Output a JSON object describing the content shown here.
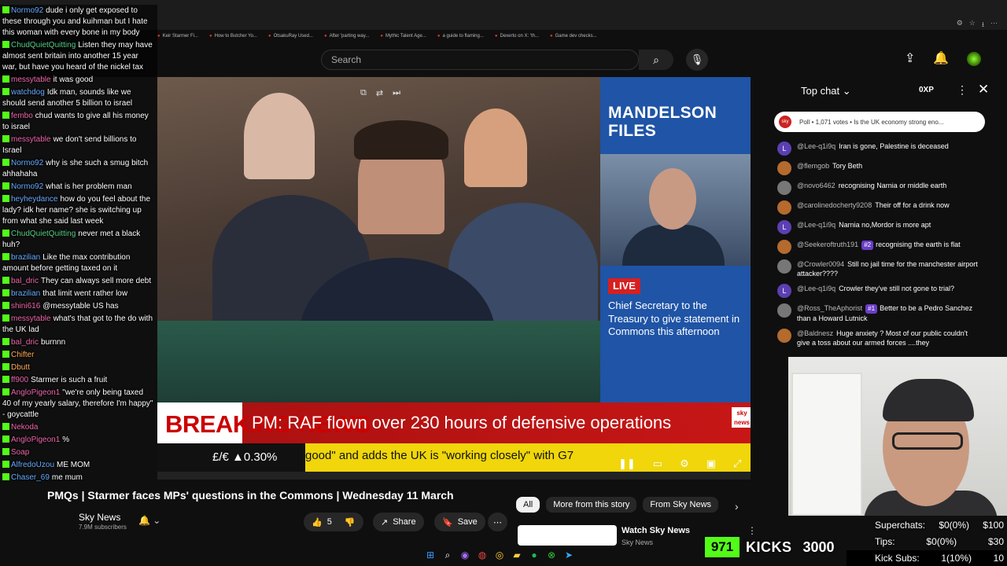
{
  "browser": {
    "bookmarks": [
      "Keir Starmer Fi...",
      "How to Butcher Yo...",
      "OtsakuRay Used...",
      "After 'parting way...",
      "Mythic Talent Age...",
      "a guide to flaming...",
      "Dexerto on X: 'th...",
      "Game dev checks..."
    ]
  },
  "header": {
    "search_placeholder": "Search"
  },
  "video": {
    "side_title": "MANDELSON FILES",
    "live_label": "LIVE",
    "side_description": "Chief Secretary to the Treasury to give statement in Commons this afternoon",
    "breaking_label": "BREAKING NEWS",
    "headline": "PM: RAF flown over 230 hours of defensive operations",
    "sky_logo": "sky news",
    "currency": "£/€ ▲0.30%",
    "ticker": "good\" and adds the UK is \"working closely\" with G7"
  },
  "below": {
    "title": "PMQs | Starmer faces MPs' questions in the Commons | Wednesday 11 March",
    "channel": "Sky News",
    "subscribers": "7.9M subscribers",
    "likes": "5",
    "share_label": "Share",
    "save_label": "Save",
    "chips": [
      "All",
      "More from this story",
      "From Sky News"
    ],
    "rec_title": "Watch Sky News",
    "rec_channel": "Sky News"
  },
  "stream_chat": [
    {
      "user": "Normo92",
      "text": "dude i only get exposed to these through you and kuihman but I hate this woman with every bone in my body",
      "c": "c1"
    },
    {
      "user": "ChudQuietQuitting",
      "text": "Listen they may have almost sent britain into another 15 year war, but have you heard of the nickel tax",
      "c": "c2"
    },
    {
      "user": "messytable",
      "text": "it was good",
      "c": "c3"
    },
    {
      "user": "watchdog",
      "text": "Idk man, sounds like we should send another 5 billion to israel",
      "c": "c1"
    },
    {
      "user": "fembo",
      "text": "chud wants to give all his money to israel",
      "c": "c3"
    },
    {
      "user": "messytable",
      "text": "we don't send billions to Israel",
      "c": "c3"
    },
    {
      "user": "Normo92",
      "text": "why is she such a smug bitch ahhahaha",
      "c": "c1"
    },
    {
      "user": "Normo92",
      "text": "what is her problem man",
      "c": "c1"
    },
    {
      "user": "heyheydance",
      "text": "how do you feel about the lady? idk her name? she is switching up from what she said last week",
      "c": "c1"
    },
    {
      "user": "ChudQuietQuitting",
      "text": "never met a black huh?",
      "c": "c2"
    },
    {
      "user": "brazilian",
      "text": "Like the max contribution amount before getting taxed on it",
      "c": "c1"
    },
    {
      "user": "bal_dric",
      "text": "They can always sell more debt",
      "c": "c3"
    },
    {
      "user": "brazilian",
      "text": "that limit went rather low",
      "c": "c1"
    },
    {
      "user": "shini616",
      "text": "@messytable US has",
      "c": "c3"
    },
    {
      "user": "messytable",
      "text": "what's that got to the do with the UK lad",
      "c": "c3"
    },
    {
      "user": "bal_dric",
      "text": "burnnn",
      "c": "c3"
    },
    {
      "user": "Chifter",
      "text": "",
      "c": "c4"
    },
    {
      "user": "Dbutt",
      "text": "",
      "c": "c4"
    },
    {
      "user": "ff900",
      "text": "Starmer is such a fruit",
      "c": "c3"
    },
    {
      "user": "AngloPigeon1",
      "text": "\"we're only being taxed 40 of my yearly salary, therefore I'm happy\" - goycattle",
      "c": "c3"
    },
    {
      "user": "Nekoda",
      "text": "",
      "c": "c3"
    },
    {
      "user": "AngloPigeon1",
      "text": "%",
      "c": "c3"
    },
    {
      "user": "Soap",
      "text": "",
      "c": "c3"
    },
    {
      "user": "AlfredoUzou",
      "text": "ME MOM",
      "c": "c1"
    },
    {
      "user": "Chaser_69",
      "text": "me mum",
      "c": "c1"
    }
  ],
  "live_chat": {
    "title": "Top chat",
    "xp": "0XP",
    "poll": "Poll • 1,071 votes • Is the UK economy strong eno...",
    "messages": [
      {
        "av": "L",
        "user": "@Lee-q1i9q",
        "badge": "",
        "text": "Iran is gone, Palestine is deceased"
      },
      {
        "av": "",
        "user": "@flemgob",
        "badge": "",
        "text": "Tory Beth"
      },
      {
        "av": "",
        "user": "@novo6462",
        "badge": "",
        "text": "recognising Narnia or middle earth"
      },
      {
        "av": "",
        "user": "@carolinedocherty9208",
        "badge": "",
        "text": "Their off for a drink now"
      },
      {
        "av": "L",
        "user": "@Lee-q1i9q",
        "badge": "",
        "text": "Narnia no,Mordor is more apt"
      },
      {
        "av": "",
        "user": "@Seekeroftruth191",
        "badge": "#2",
        "text": "recognising the earth is flat"
      },
      {
        "av": "",
        "user": "@Crowler0094",
        "badge": "",
        "text": "Still no jail time for the manchester airport attacker????"
      },
      {
        "av": "L",
        "user": "@Lee-q1i9q",
        "badge": "",
        "text": "Crowler they've still not gone to trial?"
      },
      {
        "av": "",
        "user": "@Ross_TheAphorist",
        "badge": "#1",
        "text": "Better to be a Pedro Sanchez than a Howard Lutnick"
      },
      {
        "av": "",
        "user": "@Baldnesz",
        "badge": "",
        "text": "Huge anxiety ? Most of our public couldn't give a toss about our armed forces ....they"
      }
    ]
  },
  "stats": {
    "superchats_label": "Superchats:",
    "superchats_value": "$0(0%)",
    "superchats_goal": "$100",
    "tips_label": "Tips:",
    "tips_value": "$0(0%)",
    "tips_goal": "$30",
    "kicksubs_label": "Kick Subs:",
    "kicksubs_value": "1(10%)",
    "kicksubs_goal": "10",
    "kicks_count": "971",
    "kicks_label": "KICKS",
    "kicks_goal": "3000"
  }
}
